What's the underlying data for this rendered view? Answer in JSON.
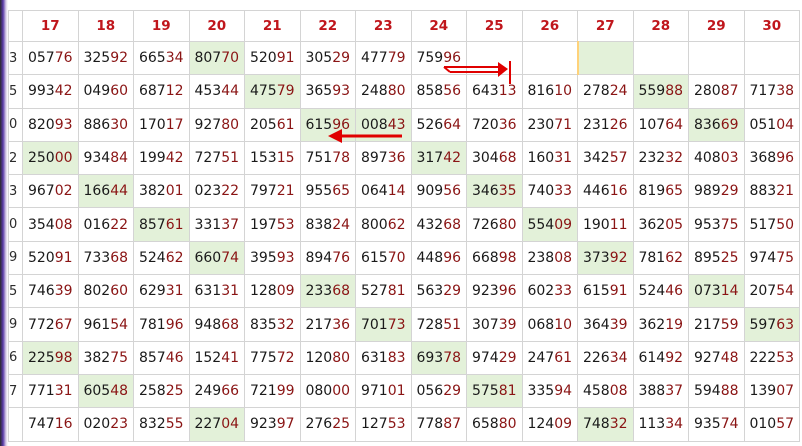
{
  "columns": [
    "17",
    "18",
    "19",
    "20",
    "21",
    "22",
    "23",
    "24",
    "25",
    "26",
    "27",
    "28",
    "29",
    "30"
  ],
  "side_digits": [
    "3",
    "5",
    "0",
    "2",
    "3",
    "0",
    "9",
    "5",
    "9",
    "6",
    "7",
    ""
  ],
  "rows": [
    [
      "05776",
      "32592",
      "66534",
      "80770",
      "52091",
      "30529",
      "47779",
      "75996",
      "",
      "",
      "",
      "",
      "",
      ""
    ],
    [
      "99342",
      "04960",
      "68712",
      "45344",
      "47579",
      "36593",
      "24880",
      "85856",
      "64313",
      "81610",
      "27824",
      "55988",
      "28087",
      "71738"
    ],
    [
      "82093",
      "88630",
      "17017",
      "92780",
      "20561",
      "61596",
      "00843",
      "52664",
      "72036",
      "23071",
      "23126",
      "10764",
      "83669",
      "05104"
    ],
    [
      "25000",
      "93484",
      "19942",
      "72751",
      "15315",
      "75178",
      "89736",
      "31742",
      "30468",
      "16031",
      "34257",
      "23232",
      "40803",
      "36896"
    ],
    [
      "96702",
      "16644",
      "38201",
      "02322",
      "79721",
      "95565",
      "06414",
      "90956",
      "34635",
      "74033",
      "44616",
      "81965",
      "98929",
      "88321"
    ],
    [
      "35408",
      "01622",
      "85761",
      "33137",
      "19753",
      "83824",
      "80062",
      "43268",
      "72680",
      "55409",
      "19011",
      "36205",
      "95375",
      "51750"
    ],
    [
      "52091",
      "73368",
      "52462",
      "66074",
      "39593",
      "89476",
      "61570",
      "44896",
      "66898",
      "23808",
      "37392",
      "78162",
      "89525",
      "97475"
    ],
    [
      "74639",
      "80260",
      "62931",
      "63131",
      "12809",
      "23368",
      "52781",
      "56329",
      "92396",
      "60233",
      "61591",
      "52446",
      "07314",
      "20754"
    ],
    [
      "77267",
      "96154",
      "78196",
      "94868",
      "83532",
      "21736",
      "70173",
      "72851",
      "30739",
      "06810",
      "36439",
      "36219",
      "21759",
      "59763"
    ],
    [
      "22598",
      "38275",
      "85746",
      "15241",
      "77572",
      "12080",
      "63183",
      "69378",
      "97429",
      "24761",
      "22634",
      "61492",
      "92748",
      "22253"
    ],
    [
      "77131",
      "60548",
      "25825",
      "24966",
      "72199",
      "08000",
      "97101",
      "05629",
      "57581",
      "33594",
      "45808",
      "38837",
      "59488",
      "13907"
    ],
    [
      "74716",
      "02023",
      "83255",
      "22704",
      "92397",
      "27625",
      "12753",
      "77887",
      "65880",
      "12409",
      "74832",
      "11334",
      "93574",
      "01057"
    ]
  ],
  "highlights": [
    [
      0,
      3
    ],
    [
      0,
      10
    ],
    [
      1,
      4
    ],
    [
      1,
      11
    ],
    [
      2,
      5
    ],
    [
      2,
      6
    ],
    [
      2,
      12
    ],
    [
      3,
      0
    ],
    [
      3,
      7
    ],
    [
      4,
      1
    ],
    [
      4,
      8
    ],
    [
      5,
      2
    ],
    [
      5,
      9
    ],
    [
      6,
      3
    ],
    [
      6,
      10
    ],
    [
      7,
      5
    ],
    [
      7,
      12
    ],
    [
      8,
      6
    ],
    [
      8,
      13
    ],
    [
      9,
      0
    ],
    [
      9,
      7
    ],
    [
      10,
      1
    ],
    [
      10,
      8
    ],
    [
      11,
      3
    ],
    [
      11,
      10
    ]
  ],
  "colors": {
    "header_text": "#c0161c",
    "highlight_bg": "#e3f1d9",
    "arrow": "#e00000",
    "grid_line": "#d4d4d4"
  }
}
